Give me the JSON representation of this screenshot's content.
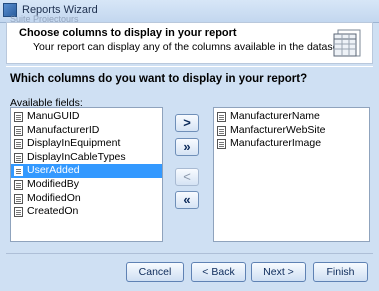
{
  "window": {
    "title": "Reports Wizard",
    "ghost_text": "Suite Projectours"
  },
  "header": {
    "title": "Choose columns to display in your report",
    "subtitle": "Your report can display any of the columns available in the dataset."
  },
  "question": "Which columns do you want to display in your report?",
  "available_label": "Available fields:",
  "available_fields": [
    {
      "label": "ManuGUID",
      "selected": false
    },
    {
      "label": "ManufacturerID",
      "selected": false
    },
    {
      "label": "DisplayInEquipment",
      "selected": false
    },
    {
      "label": "DisplayInCableTypes",
      "selected": false
    },
    {
      "label": "UserAdded",
      "selected": true
    },
    {
      "label": "ModifiedBy",
      "selected": false
    },
    {
      "label": "ModifiedOn",
      "selected": false
    },
    {
      "label": "CreatedOn",
      "selected": false
    }
  ],
  "selected_fields": [
    {
      "label": "ManufacturerName"
    },
    {
      "label": "ManfacturerWebSite"
    },
    {
      "label": "ManufacturerImage"
    }
  ],
  "move_buttons": {
    "add": ">",
    "add_all": "»",
    "remove": "<",
    "remove_all": "«"
  },
  "footer": {
    "cancel": "Cancel",
    "back": "< Back",
    "next": "Next >",
    "finish": "Finish"
  }
}
